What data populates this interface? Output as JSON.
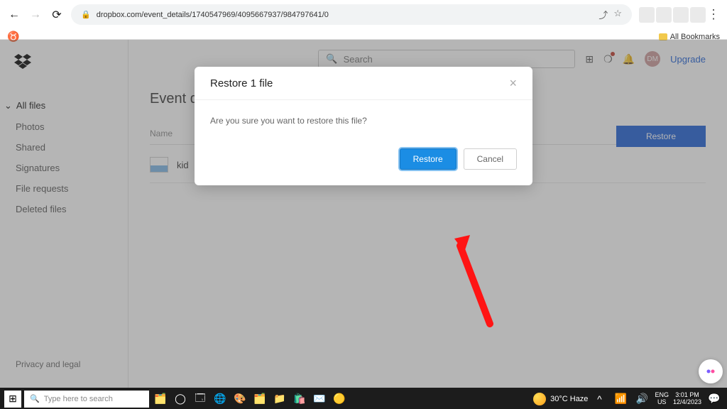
{
  "chrome": {
    "back_icon": "←",
    "forward_icon": "→",
    "reload_icon": "⟳",
    "lock_icon": "🔒",
    "url": "dropbox.com/event_details/1740547969/4095667937/984797641/0",
    "share_icon": "⤴",
    "star_icon": "☆",
    "menu_icon": "⋮",
    "brave_icon": "♉",
    "bookmarks_label": "All Bookmarks"
  },
  "sidebar": {
    "items": [
      {
        "label": "All files",
        "selected": true
      },
      {
        "label": "Photos"
      },
      {
        "label": "Shared"
      },
      {
        "label": "Signatures"
      },
      {
        "label": "File requests"
      },
      {
        "label": "Deleted files"
      }
    ],
    "footer": "Privacy and legal"
  },
  "header": {
    "search_placeholder": "Search",
    "avatar_initials": "DM",
    "upgrade_label": "Upgrade"
  },
  "page": {
    "title": "Event details",
    "column_name": "Name",
    "row_name": "kid",
    "restore_label": "Restore"
  },
  "modal": {
    "title": "Restore 1 file",
    "message": "Are you sure you want to restore this file?",
    "restore": "Restore",
    "cancel": "Cancel"
  },
  "taskbar": {
    "search_placeholder": "Type here to search",
    "weather": "30°C Haze",
    "lang1": "ENG",
    "lang2": "US",
    "time": "3:01 PM",
    "date": "12/4/2023"
  }
}
